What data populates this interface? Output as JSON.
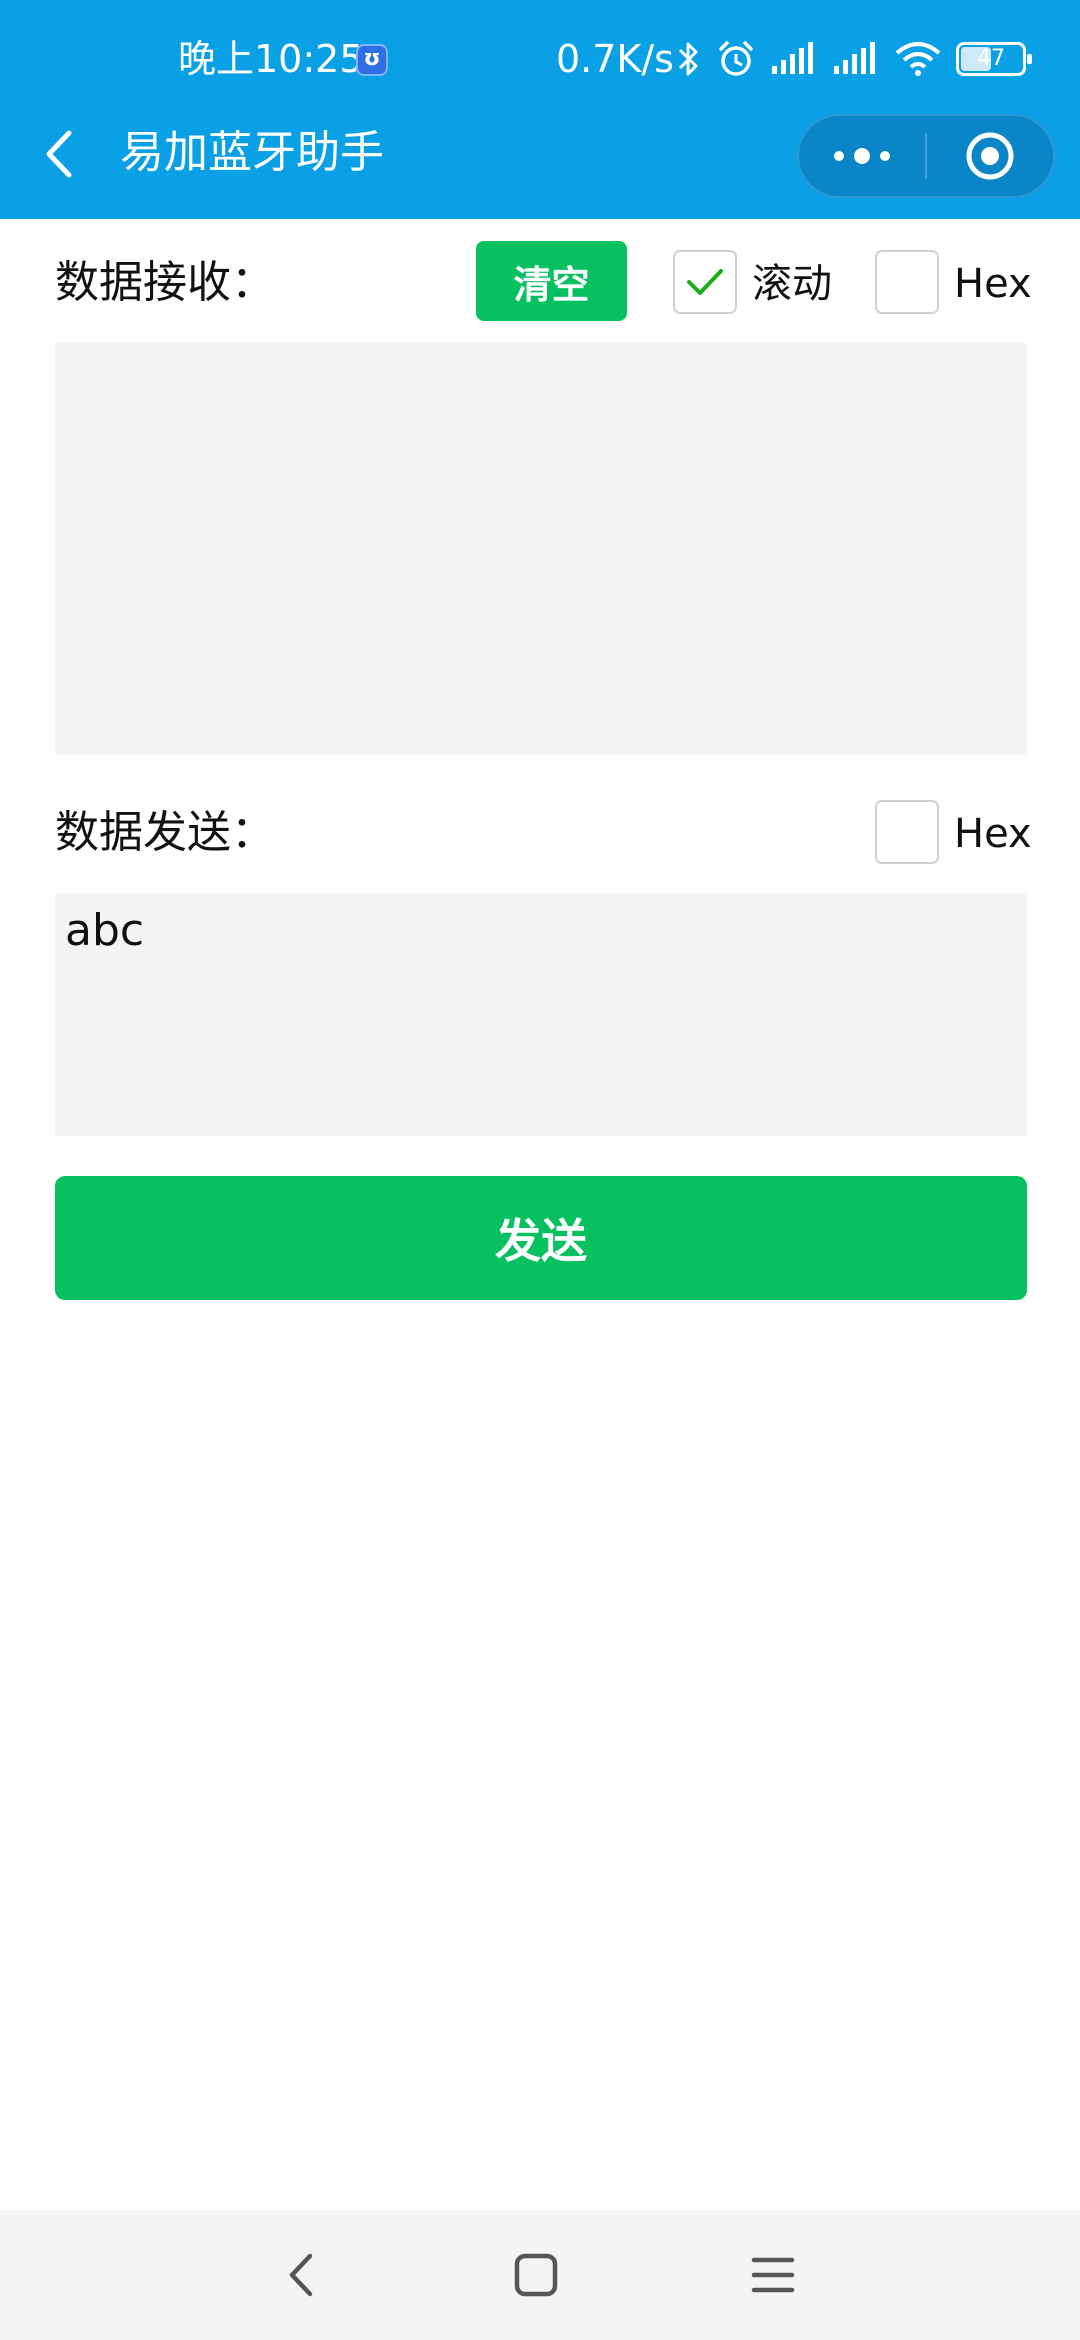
{
  "status_bar": {
    "time": "晚上10:25",
    "app_icon_glyph": "ʊ",
    "network_speed": "0.7K/s",
    "battery_level": "47",
    "icons": [
      "bluetooth-icon",
      "alarm-icon",
      "signal-icon",
      "signal-icon",
      "wifi-icon",
      "battery-icon"
    ]
  },
  "header": {
    "title": "易加蓝牙助手",
    "background_color": "#0aa0e6"
  },
  "receive": {
    "label": "数据接收：",
    "clear_button": "清空",
    "scroll_label": "滚动",
    "scroll_checked": true,
    "hex_label": "Hex",
    "hex_checked": false,
    "content": ""
  },
  "send": {
    "label": "数据发送：",
    "hex_label": "Hex",
    "hex_checked": false,
    "input_value": "abc",
    "send_button": "发送"
  },
  "colors": {
    "accent_green": "#07c160",
    "area_gray": "#f4f4f4"
  }
}
